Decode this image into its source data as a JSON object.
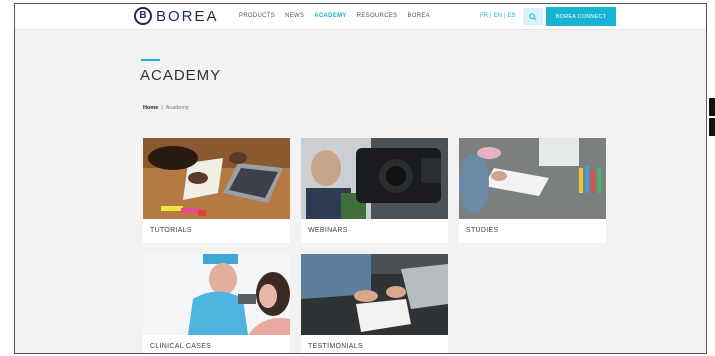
{
  "header": {
    "logo_mark": "B",
    "logo_text": "BOREA",
    "nav": [
      "PRODUCTS",
      "NEWS",
      "ACADEMY",
      "RESOURCES",
      "BOREA"
    ],
    "active_nav": "ACADEMY",
    "languages": [
      "FR",
      "EN",
      "ES"
    ],
    "active_language": "EN",
    "connect_label": "BOREA CONNECT"
  },
  "page": {
    "title": "ACADEMY",
    "breadcrumb_home": "Home",
    "breadcrumb_separator": "|",
    "breadcrumb_current": "Academy"
  },
  "cards": [
    {
      "label": "TUTORIALS"
    },
    {
      "label": "WEBINARS"
    },
    {
      "label": "STUDIES"
    },
    {
      "label": "CLINICAL CASES"
    },
    {
      "label": "TESTIMONIALS"
    }
  ],
  "colors": {
    "accent": "#19b3d3",
    "brand": "#1d2b4f"
  }
}
